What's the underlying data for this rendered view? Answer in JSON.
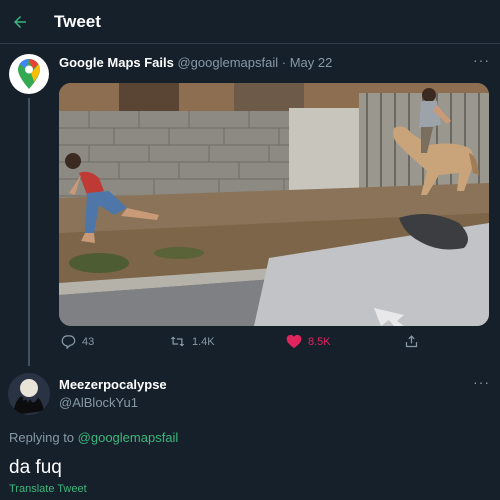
{
  "header": {
    "title": "Tweet"
  },
  "colors": {
    "background": "#15202b",
    "accent": "#3fb57b",
    "like": "#e0245e",
    "muted": "#8899a6"
  },
  "tweet": {
    "author_name": "Google Maps Fails",
    "author_handle": "@googlemapsfail",
    "separator": " · ",
    "date": "May 22",
    "avatar_icon": "google-maps-pin-icon",
    "more_icon": "more-icon",
    "more_glyph": "···",
    "actions": {
      "reply_count": "43",
      "retweet_count": "1.4K",
      "like_count": "8.5K",
      "liked": true
    }
  },
  "reply": {
    "author_name": "Meezerpocalypse",
    "author_handle": "@AlBlockYu1",
    "replying_prefix": "Replying to",
    "replying_to": "@googlemapsfail",
    "text": "da fuq",
    "translate_label": "Translate Tweet",
    "more_glyph": "···"
  }
}
